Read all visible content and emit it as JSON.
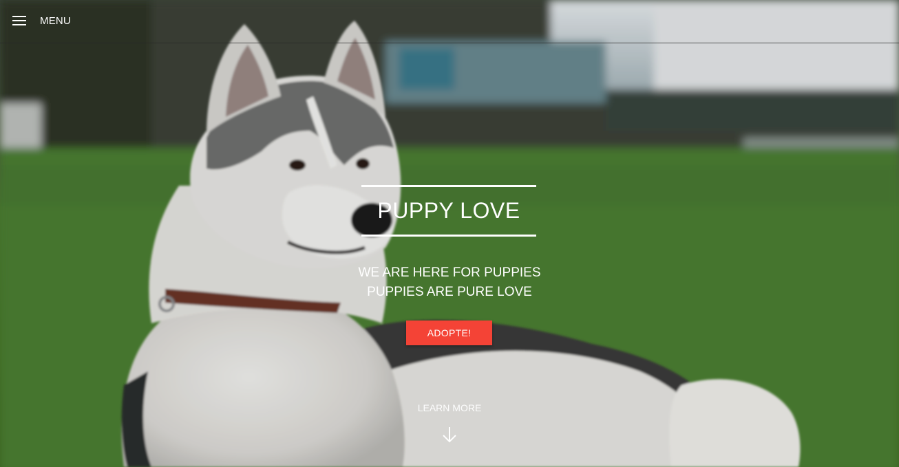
{
  "nav": {
    "menu_label": "MENU"
  },
  "hero": {
    "title": "PUPPY LOVE",
    "subtitle_line1": "WE ARE HERE FOR PUPPIES",
    "subtitle_line2": "PUPPIES ARE PURE LOVE",
    "cta_label": "ADOPTE!",
    "learn_more_label": "LEARN MORE"
  },
  "colors": {
    "cta": "#f44336",
    "text": "#ffffff",
    "grass": "#4a7a31"
  },
  "icons": {
    "menu": "hamburger-icon",
    "scroll": "arrow-down-icon"
  }
}
